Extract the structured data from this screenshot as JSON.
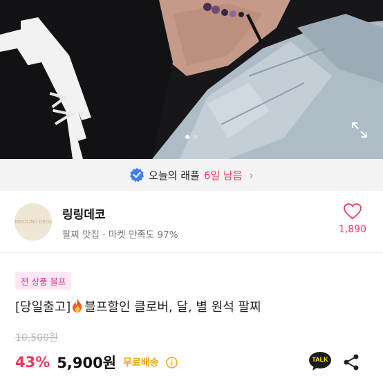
{
  "photo": {
    "alt_icons": [
      "expand-icon"
    ],
    "slide_count": 2,
    "active_slide": 0
  },
  "raffle": {
    "label": "오늘의 래플",
    "time_left": "6일 남음",
    "chevron": "›"
  },
  "seller": {
    "name": "링링데코",
    "subtitle": "팔찌 맛집 · 마켓 만족도 97%",
    "logo_text": "RINGLING DECO",
    "like_count": "1,890"
  },
  "product": {
    "promo_badge": "전 상품 블프",
    "title_prefix": "[당일출고]",
    "title_rest": "블프할인 클로버, 달, 별 원석 팔찌",
    "original_price": "10,500원",
    "discount": "43%",
    "price": "5,900원",
    "shipping": "무료배송"
  },
  "actions": {
    "talk_label": "TALK"
  },
  "colors": {
    "accent": "#f0375a",
    "promo_text": "#d23c9a",
    "promo_bg": "#fbe8f3",
    "shipping": "#f2a31a",
    "verified": "#3d7ef5"
  }
}
